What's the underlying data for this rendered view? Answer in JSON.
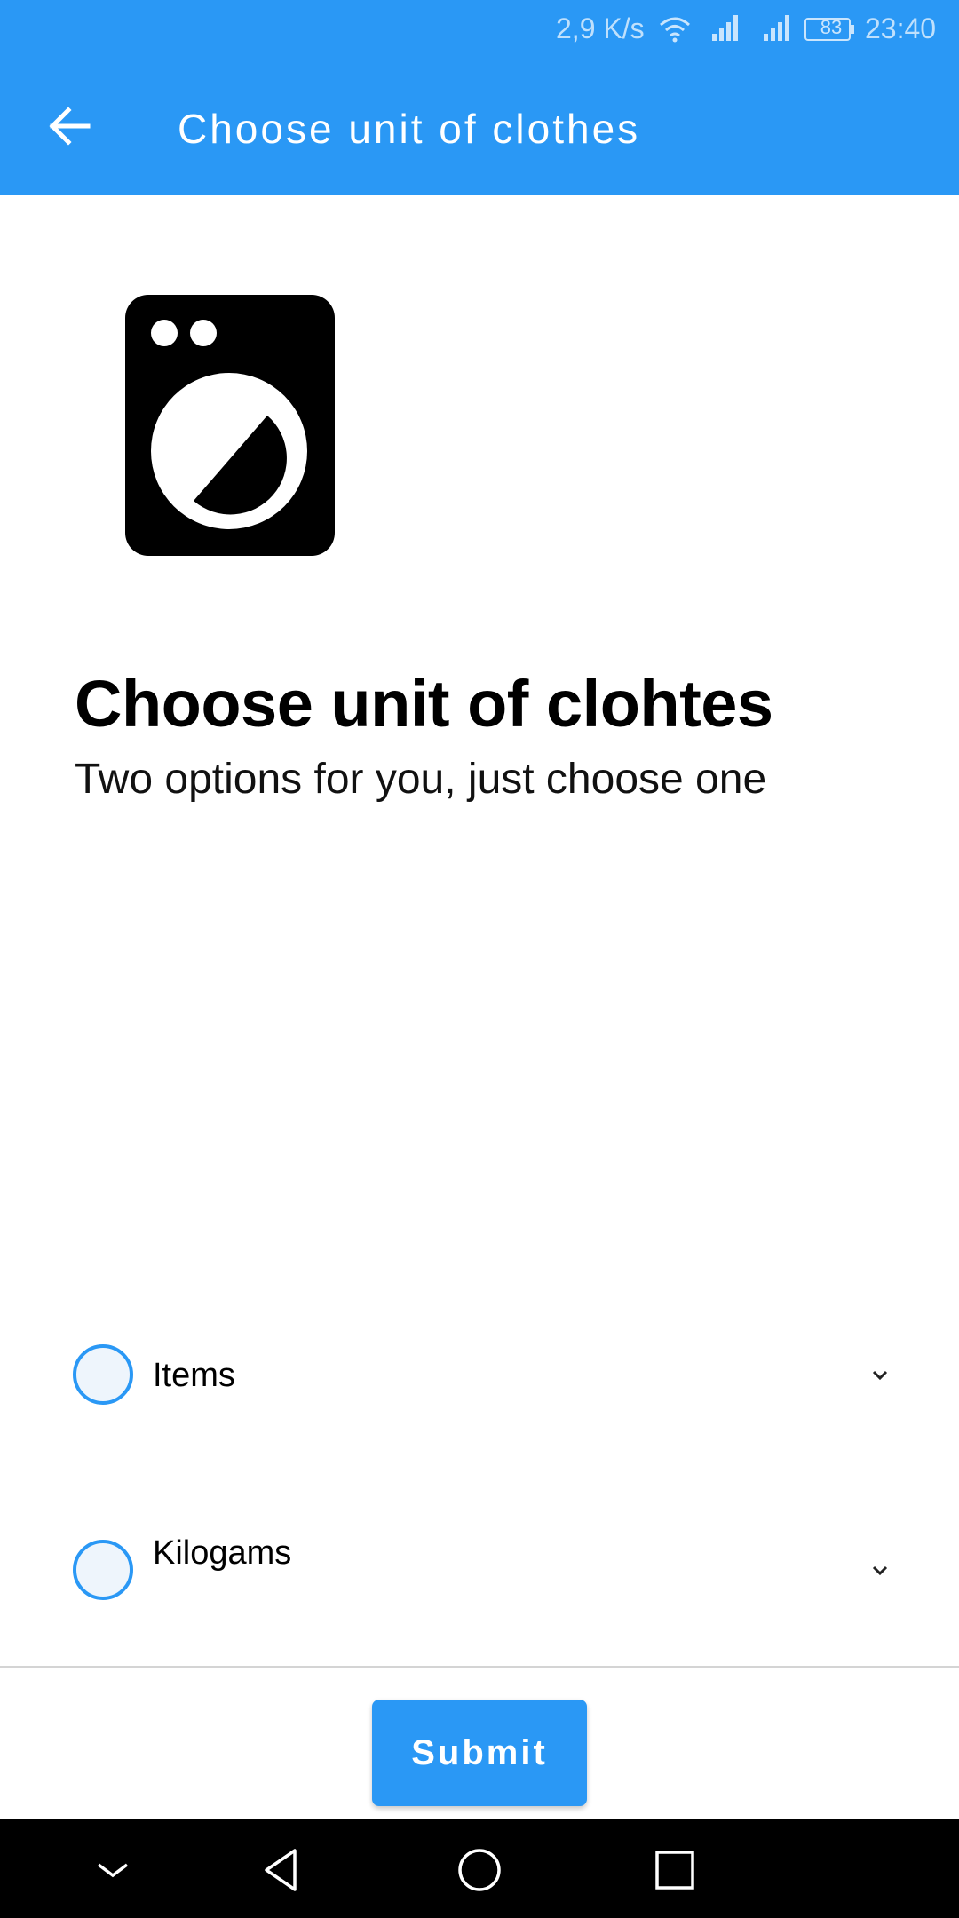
{
  "status_bar": {
    "net_speed": "2,9 K/s",
    "battery": "83",
    "time": "23:40"
  },
  "app_bar": {
    "title": "Choose unit of clothes",
    "background_color": "#2a98f5"
  },
  "illustration": {
    "icon": "washing-machine-icon"
  },
  "content": {
    "headline": "Choose unit of clohtes",
    "subhead": "Two options for you, just choose one"
  },
  "options": [
    {
      "label": "Items",
      "selected": false
    },
    {
      "label": "Kilogams",
      "selected": false
    }
  ],
  "submit": {
    "label": "Submit"
  },
  "nav_bar": {
    "icons": [
      "chevron-down-icon",
      "back-triangle-icon",
      "home-circle-icon",
      "recents-square-icon"
    ]
  }
}
